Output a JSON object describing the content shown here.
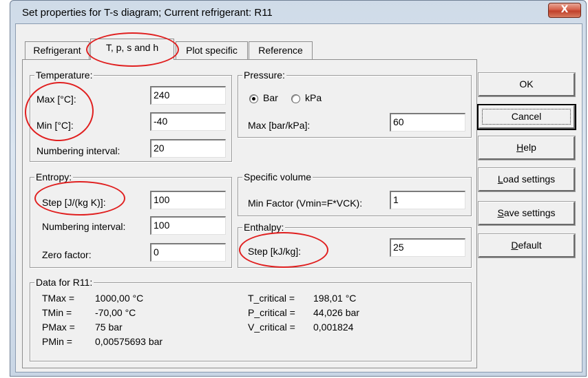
{
  "window": {
    "title": "Set properties for T-s diagram; Current refrigerant: R11",
    "close_glyph": "X"
  },
  "tabs": [
    {
      "label": "Refrigerant"
    },
    {
      "label": "T, p, s and h",
      "active": true
    },
    {
      "label": "Plot specific"
    },
    {
      "label": "Reference"
    }
  ],
  "temperature": {
    "title": "Temperature:",
    "max_label": "Max [°C]:",
    "max_value": "240",
    "min_label": "Min [°C]:",
    "min_value": "-40",
    "interval_label": "Numbering interval:",
    "interval_value": "20"
  },
  "pressure": {
    "title": "Pressure:",
    "unit_options": [
      "Bar",
      "kPa"
    ],
    "unit_selected": "Bar",
    "max_label": "Max [bar/kPa]:",
    "max_value": "60"
  },
  "entropy": {
    "title": "Entropy:",
    "step_label": "Step [J/(kg K)]:",
    "step_value": "100",
    "interval_label": "Numbering interval:",
    "interval_value": "100",
    "zero_label": "Zero factor:",
    "zero_value": "0"
  },
  "specific_volume": {
    "title": "Specific volume",
    "factor_label": "Min Factor (Vmin=F*VCK):",
    "factor_value": "1"
  },
  "enthalpy": {
    "title": "Enthalpy:",
    "step_label": "Step [kJ/kg]:",
    "step_value": "25"
  },
  "data_group": {
    "title": "Data for R11:",
    "left": [
      {
        "name": "TMax =",
        "value": "1000,00 °C"
      },
      {
        "name": "TMin =",
        "value": "-70,00 °C"
      },
      {
        "name": "PMax =",
        "value": "75 bar"
      },
      {
        "name": "PMin =",
        "value": "0,00575693 bar"
      }
    ],
    "right": [
      {
        "name": "T_critical =",
        "value": "198,01 °C"
      },
      {
        "name": "P_critical =",
        "value": "44,026 bar"
      },
      {
        "name": "V_critical =",
        "value": "0,001824"
      }
    ]
  },
  "buttons": {
    "ok": "OK",
    "cancel": "Cancel",
    "help": "Help",
    "load": "Load settings",
    "save": "Save settings",
    "default": "Default"
  },
  "colors": {
    "annotation": "#e01f1f",
    "title_bar": "#dce6f1",
    "dialog_face": "#f0f0f0",
    "close_button": "#c0402a"
  },
  "annotations": [
    "tab-t-p-s-h",
    "temperature-max-min-labels",
    "entropy-step-label",
    "enthalpy-step-label"
  ]
}
